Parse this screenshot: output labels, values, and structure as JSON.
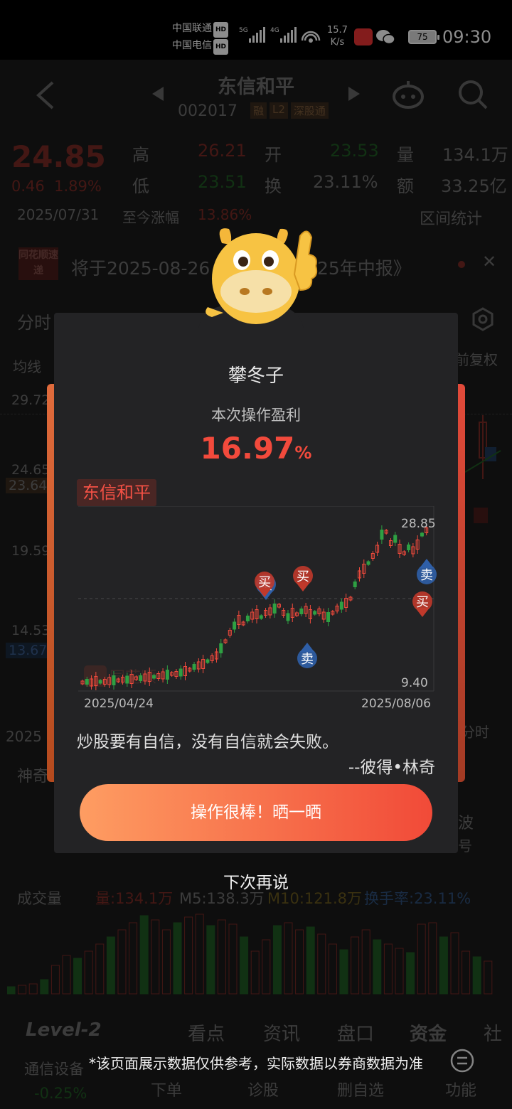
{
  "status_bar": {
    "carrier1": "中国联通",
    "carrier2": "中国电信",
    "hd": "HD",
    "net1": "5G",
    "net2": "4G",
    "speed_value": "15.7",
    "speed_unit": "K/s",
    "battery": "75",
    "time": "09:30"
  },
  "header": {
    "title": "东信和平",
    "code": "002017",
    "badges": [
      "融",
      "L2",
      "深股通"
    ]
  },
  "quote": {
    "price": "24.85",
    "change": "0.46",
    "change_pct": "1.89%",
    "high_label": "高",
    "high": "26.21",
    "open_label": "开",
    "open": "23.53",
    "volume_label": "量",
    "volume": "134.1万",
    "low_label": "低",
    "low": "23.51",
    "turnover_label": "换",
    "turnover": "23.11%",
    "amount_label": "额",
    "amount": "33.25亿",
    "date": "2025/07/31",
    "since_label": "至今涨幅",
    "since_value": "13.86%",
    "range_stats": "区间统计"
  },
  "notice": {
    "brand": "同花顺速递",
    "text_left": "将于2025-08-26",
    "text_right": "25年中报》"
  },
  "chart_bg": {
    "tab": "分时",
    "ma": "均线",
    "adjust": "前复权",
    "prices": [
      "29.72",
      "24.65",
      "23.64",
      "19.59",
      "14.53",
      "13.67"
    ],
    "date": "2025",
    "fenshi": "分时",
    "shenqi": "神奇",
    "bo": "波",
    "hao": "号"
  },
  "volume_bar": {
    "label": "成交量",
    "vol": "量:134.1万",
    "m5": "M5:138.3万",
    "m10": "M10:121.8万",
    "turnover": "换手率:23.11%"
  },
  "bottom_nav": {
    "tabs": [
      "Level-2",
      "看点",
      "资讯",
      "盘口",
      "资金",
      "社"
    ],
    "actions": [
      "通信设备",
      "下单",
      "诊股",
      "删自选",
      "功能"
    ],
    "sector_change": "-0.25%"
  },
  "dialog": {
    "user": "攀冬子",
    "subtitle": "本次操作盈利",
    "profit_value": "16.97",
    "profit_unit": "%",
    "stock_name": "东信和平",
    "chart_high": "28.85",
    "chart_low": "9.40",
    "date_start": "2025/04/24",
    "date_end": "2025/08/06",
    "watermark": "同花顺",
    "buy_label": "买",
    "sell_label": "卖",
    "quote": "炒股要有自信，没有自信就会失败。",
    "author": "--彼得•林奇",
    "share_button": "操作很棒！晒一晒",
    "later_button": "下次再说"
  },
  "disclaimer": "*该页面展示数据仅供参考，实际数据以券商数据为准",
  "colors": {
    "up": "#f24a3c",
    "down": "#2ea043",
    "button_start": "#fe9d62",
    "button_end": "#f14a38"
  }
}
